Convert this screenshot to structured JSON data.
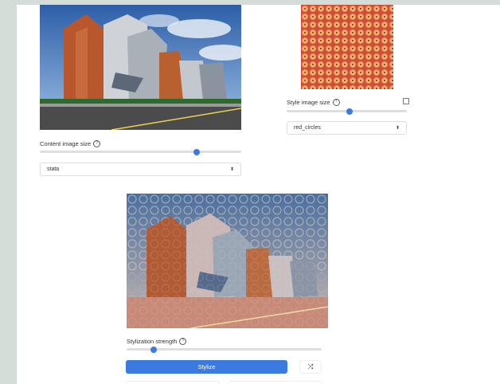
{
  "content": {
    "image_alt": "Stata Center building photo",
    "size_label": "Content image size",
    "size_level": 0.78,
    "select_value": "stata"
  },
  "style": {
    "image_alt": "red circles pattern",
    "size_label": "Style image size",
    "size_level": 0.52,
    "select_value": "red_circles"
  },
  "output": {
    "image_alt": "stylized Stata Center",
    "strength_label": "Stylization strength",
    "strength_level": 0.14,
    "stylize_label": "Stylize",
    "shuffle_icon": "shuffle-icon"
  },
  "help_glyph": "?",
  "caret_glyph": "⬍",
  "shuffle_glyph": "⤨"
}
